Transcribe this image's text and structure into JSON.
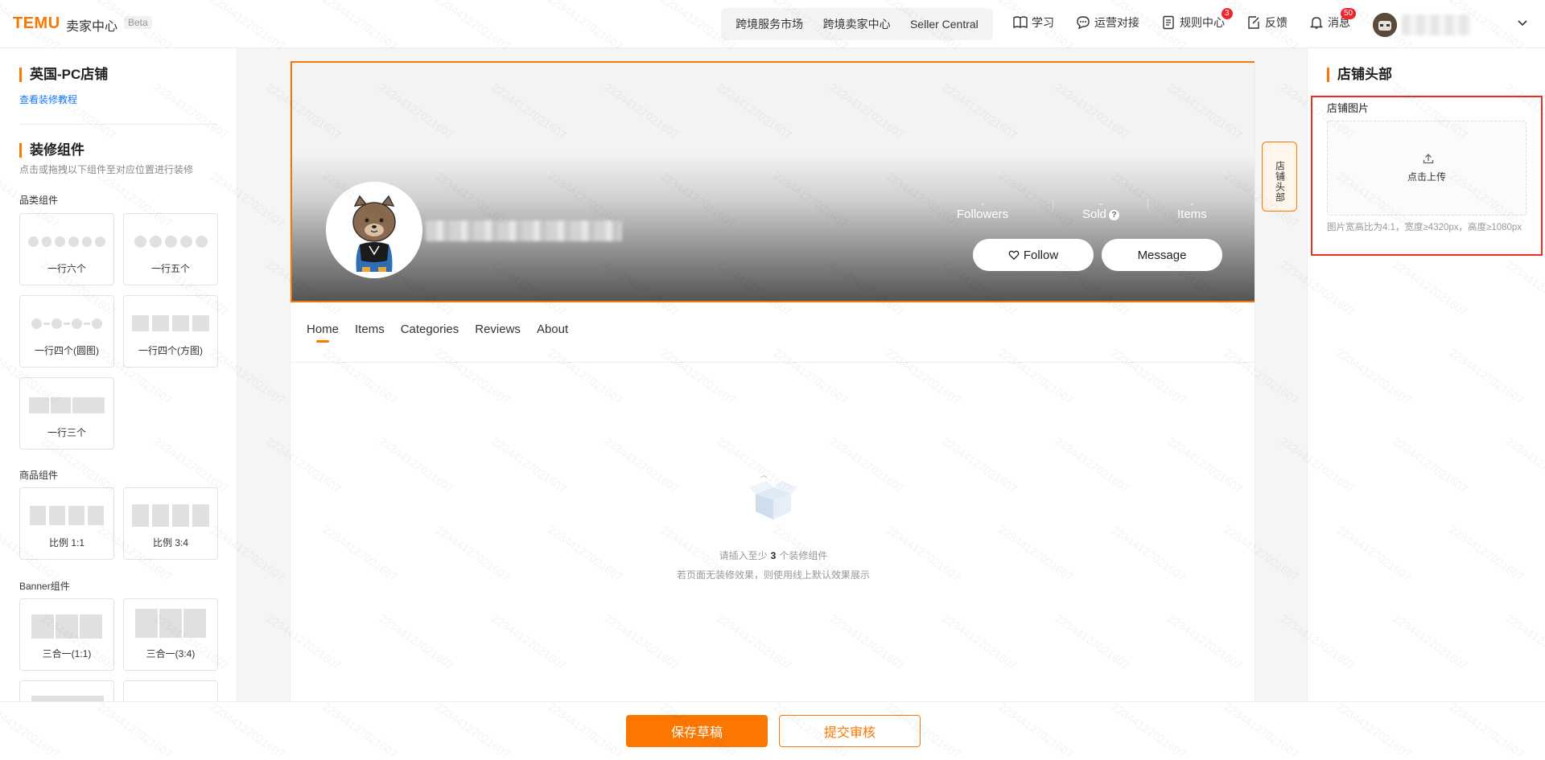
{
  "header": {
    "logo": "TEMU",
    "logo_sub": "卖家中心",
    "beta": "Beta",
    "links": [
      "跨境服务市场",
      "跨境卖家中心",
      "Seller Central"
    ],
    "nav": {
      "learn": "学习",
      "ops": "运营对接",
      "rules": "规则中心",
      "rules_badge": "3",
      "feedback": "反馈",
      "messages": "消息",
      "messages_badge": "50"
    }
  },
  "left": {
    "shop_title": "英国-PC店铺",
    "tutorial_link": "查看装修教程",
    "components_title": "装修组件",
    "components_hint": "点击或拖拽以下组件至对应位置进行装修",
    "groups": {
      "category": "品类组件",
      "product": "商品组件",
      "banner": "Banner组件"
    },
    "cards": {
      "row6": "一行六个",
      "row5": "一行五个",
      "row4_round": "一行四个(圆图)",
      "row4_square": "一行四个(方图)",
      "row3": "一行三个",
      "ratio11": "比例 1:1",
      "ratio34": "比例 3:4",
      "banner11": "三合一(1:1)",
      "banner34": "三合一(3:4)"
    }
  },
  "center": {
    "stats": {
      "followers": "Followers",
      "sold": "Sold",
      "items": "Items",
      "followers_val": "-",
      "sold_val": "-",
      "items_val": "-"
    },
    "follow_btn": "Follow",
    "message_btn": "Message",
    "tabs": [
      "Home",
      "Items",
      "Categories",
      "Reviews",
      "About"
    ],
    "active_tab": "Home",
    "empty_pre": "请插入至少",
    "empty_num": "3",
    "empty_post": "个装修组件",
    "empty_sub": "若页面无装修效果，则使用线上默认效果展示"
  },
  "floating_tag": "店铺头部",
  "right": {
    "title": "店铺头部",
    "image_label": "店铺图片",
    "upload_text": "点击上传",
    "note": "图片宽高比为4:1，宽度≥4320px，高度≥1080px"
  },
  "footer": {
    "save_draft": "保存草稿",
    "submit": "提交审核"
  },
  "watermark": "223441270216​07",
  "colors": {
    "accent": "#fb7701",
    "highlight_frame": "#e8301c",
    "badge": "#f0262c"
  }
}
